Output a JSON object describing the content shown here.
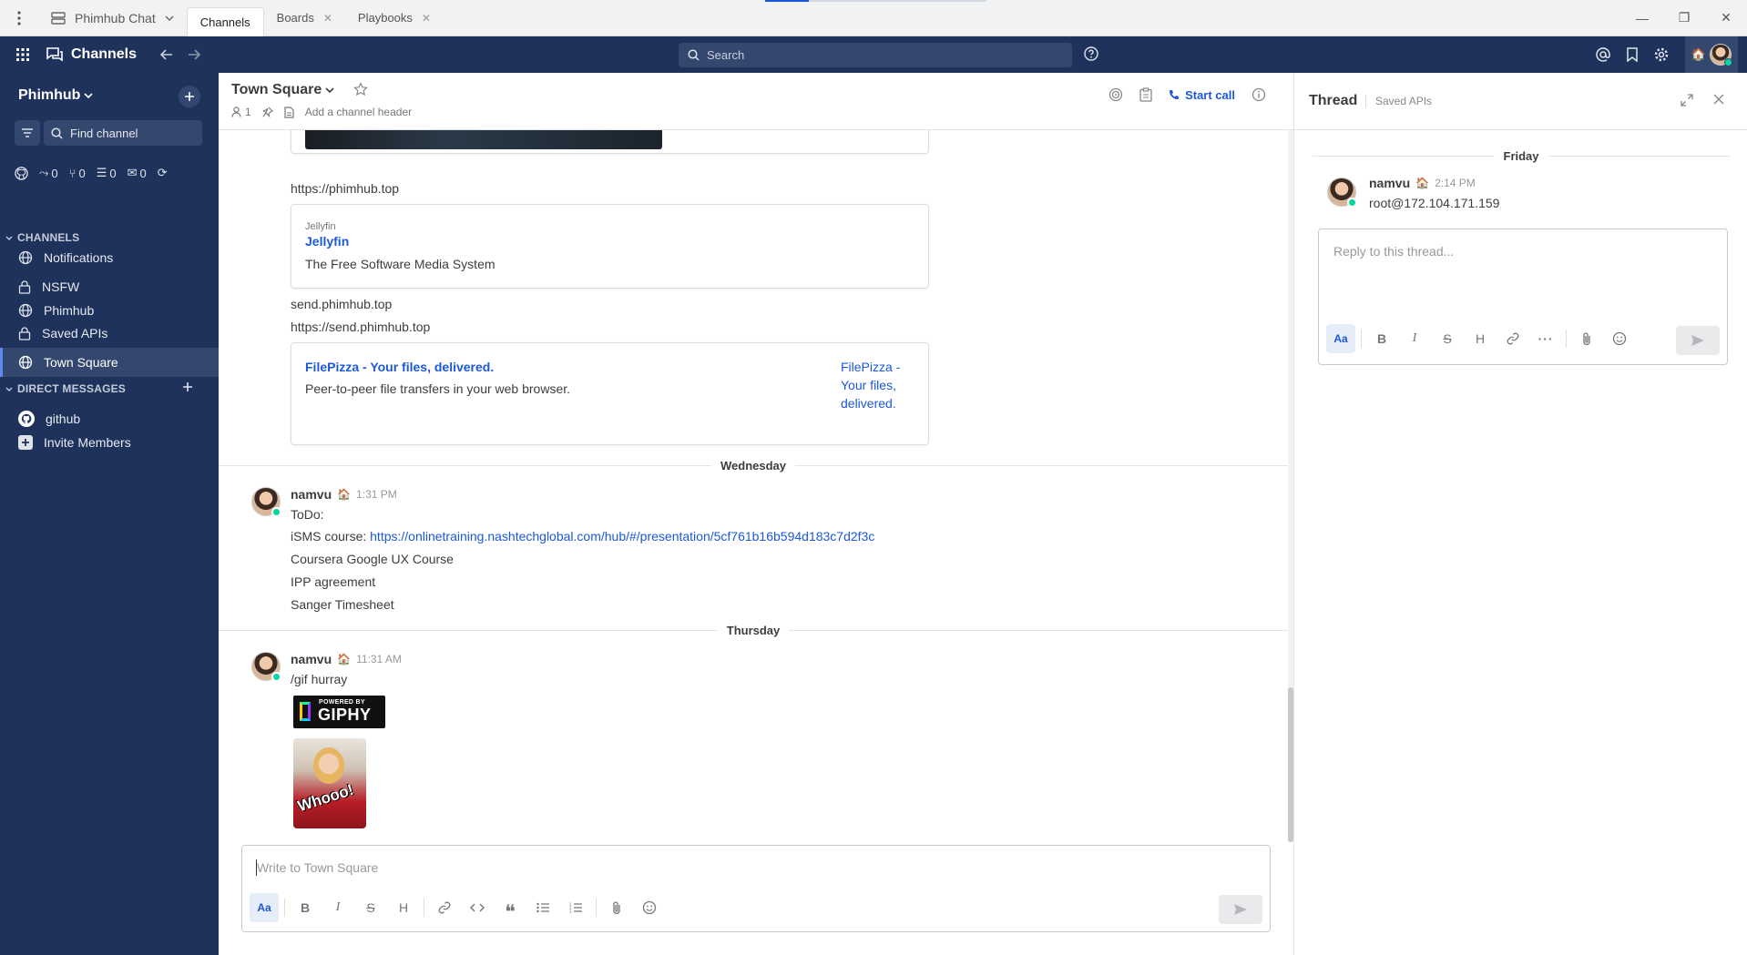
{
  "titlebar": {
    "app_name": "Phimhub Chat",
    "tabs": [
      {
        "label": "Channels",
        "active": true
      },
      {
        "label": "Boards",
        "active": false
      },
      {
        "label": "Playbooks",
        "active": false
      }
    ]
  },
  "global_header": {
    "product": "Channels",
    "search_placeholder": "Search"
  },
  "sidebar": {
    "team_name": "Phimhub",
    "find_channel": "Find channel",
    "counters": [
      "0",
      "0",
      "0",
      "0"
    ],
    "channels_header": "CHANNELS",
    "channels": [
      {
        "label": "Notifications",
        "icon": "globe-icon"
      },
      {
        "label": "NSFW",
        "icon": "lock-icon"
      },
      {
        "label": "Phimhub",
        "icon": "globe-icon"
      },
      {
        "label": "Saved APIs",
        "icon": "lock-icon"
      },
      {
        "label": "Town Square",
        "icon": "globe-icon",
        "active": true
      }
    ],
    "dm_header": "DIRECT MESSAGES",
    "dms": [
      {
        "label": "github",
        "icon": "github-icon"
      },
      {
        "label": "Invite Members",
        "icon": "plus-box-icon"
      }
    ]
  },
  "channel_header": {
    "name": "Town Square",
    "member_count": "1",
    "header_placeholder": "Add a channel header",
    "start_call": "Start call"
  },
  "messages": {
    "link1": "https://phimhub.top",
    "jellyfin": {
      "site": "Jellyfin",
      "title": "Jellyfin",
      "desc": "The Free Software Media System"
    },
    "send_text": "send.phimhub.top",
    "link2": "https://send.phimhub.top",
    "filepizza": {
      "title": "FilePizza - Your files, delivered.",
      "desc": "Peer-to-peer file transfers in your web browser.",
      "img_alt_1": "FilePizza -",
      "img_alt_2": "Your files,",
      "img_alt_3": "delivered."
    },
    "date_wed": "Wednesday",
    "msg1": {
      "user": "namvu",
      "emoji": "🏠",
      "time": "1:31 PM",
      "line1": "ToDo:",
      "isms_label": "iSMS course: ",
      "isms_link": "https://onlinetraining.nashtechglobal.com/hub/#/presentation/5cf761b16b594d183c7d2f3c",
      "line3": "Coursera Google UX Course",
      "line4": "IPP agreement",
      "line5": "Sanger Timesheet"
    },
    "date_thu": "Thursday",
    "msg2": {
      "user": "namvu",
      "emoji": "🏠",
      "time": "11:31 AM",
      "cmd": "/gif",
      "text": "hurray",
      "giphy_top": "POWERED BY",
      "giphy_main": "GIPHY",
      "gif_caption": "Whooo!"
    }
  },
  "composer": {
    "placeholder": "Write to Town Square",
    "aa": "Aa",
    "bold": "B",
    "italic": "I",
    "strike": "S",
    "heading": "H"
  },
  "rhs": {
    "title": "Thread",
    "subtitle": "Saved APIs",
    "date": "Friday",
    "post": {
      "user": "namvu",
      "emoji": "🏠",
      "time": "2:14 PM",
      "text": "root@172.104.171.159"
    },
    "reply_placeholder": "Reply to this thread...",
    "aa": "Aa",
    "bold": "B",
    "italic": "I",
    "strike": "S",
    "heading": "H"
  },
  "colors": {
    "sidebar": "#1e325c",
    "accent": "#1c58d9",
    "online": "#06d6a0"
  }
}
